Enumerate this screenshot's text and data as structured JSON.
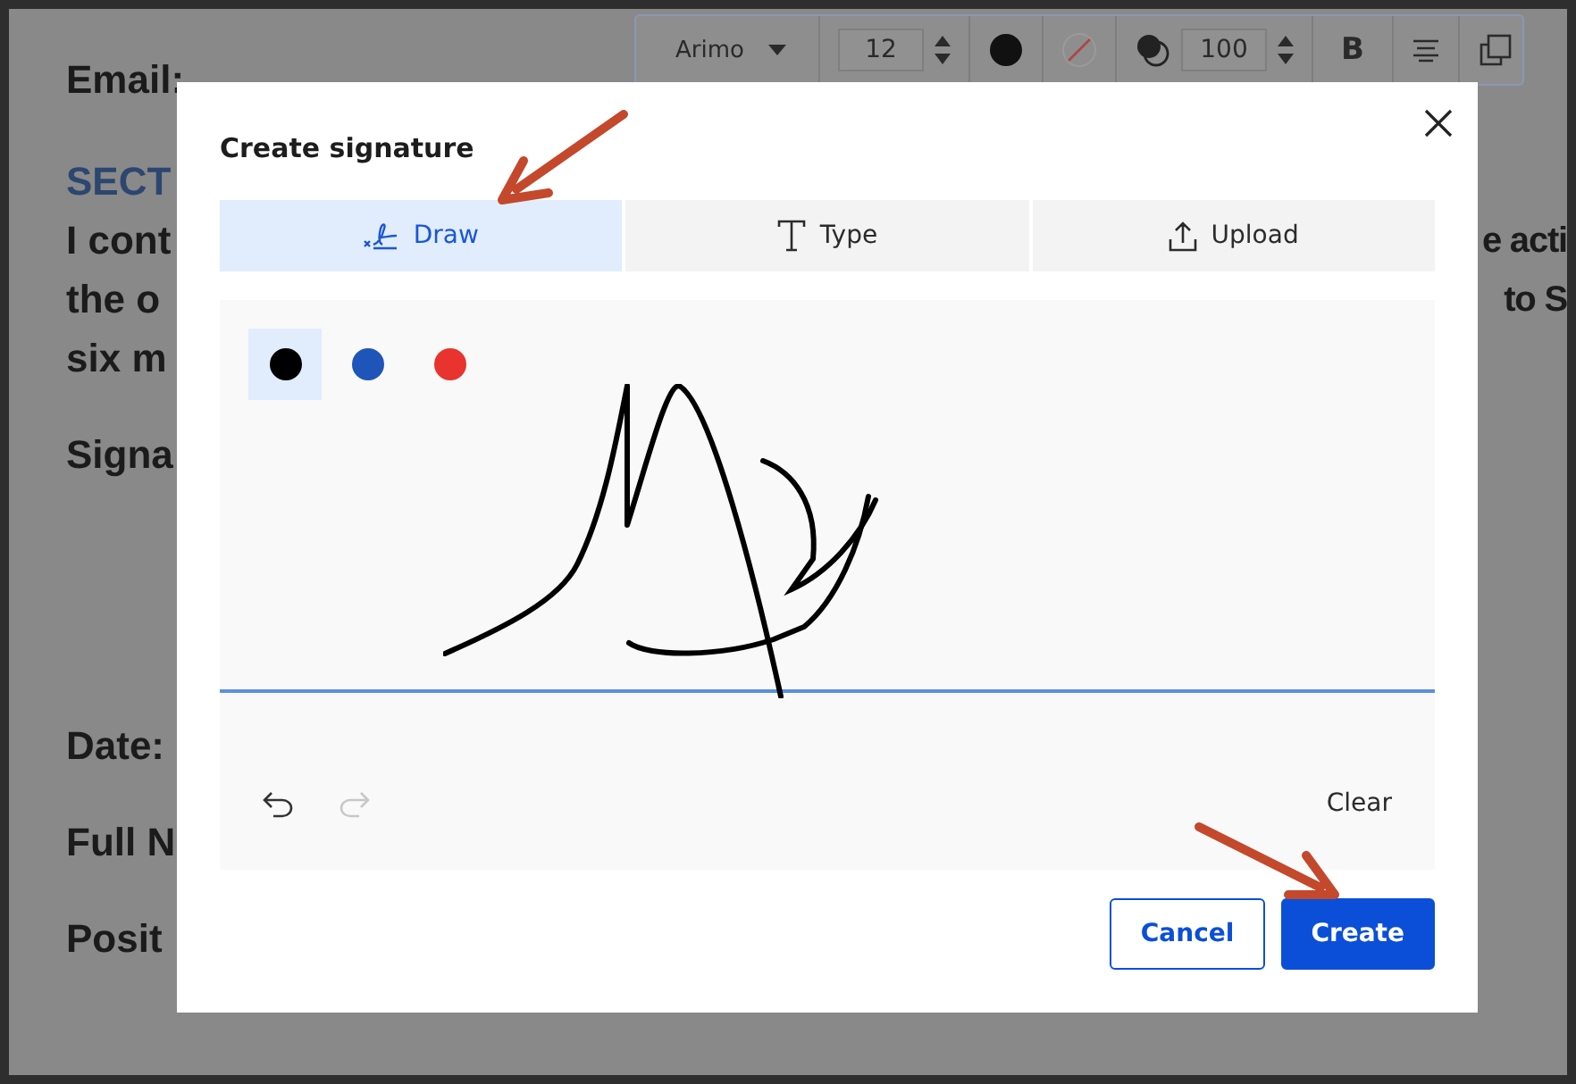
{
  "document": {
    "lines": [
      {
        "kind": "field",
        "text": "Email:"
      },
      {
        "kind": "heading",
        "text": "SECT"
      },
      {
        "kind": "body",
        "text": "I cont",
        "right": "e acti"
      },
      {
        "kind": "body",
        "text": "the o",
        "right": "to S"
      },
      {
        "kind": "body",
        "text": "six m"
      },
      {
        "kind": "signature",
        "text": "Signa"
      },
      {
        "kind": "field",
        "text": "Date:"
      },
      {
        "kind": "field",
        "text": "Full N"
      },
      {
        "kind": "field",
        "text": "Posit"
      }
    ]
  },
  "toolbar": {
    "font": "Arimo",
    "size": "12",
    "opacity": "100",
    "bold": "B"
  },
  "dialog": {
    "title": "Create signature",
    "tabs": [
      {
        "kind": "draw",
        "label": "Draw",
        "selected": true
      },
      {
        "kind": "type",
        "label": "Type",
        "selected": false
      },
      {
        "kind": "upload",
        "label": "Upload",
        "selected": false
      }
    ],
    "colors": [
      {
        "color": "#000000",
        "selected": true
      },
      {
        "color": "#1f55b8",
        "selected": false
      },
      {
        "color": "#e8332e",
        "selected": false
      }
    ],
    "undo": {
      "disabled": false
    },
    "redo": {
      "disabled": true
    },
    "clear": "Clear",
    "buttons": [
      {
        "kind": "secondary",
        "label": "Cancel"
      },
      {
        "kind": "primary",
        "label": "Create"
      }
    ]
  }
}
